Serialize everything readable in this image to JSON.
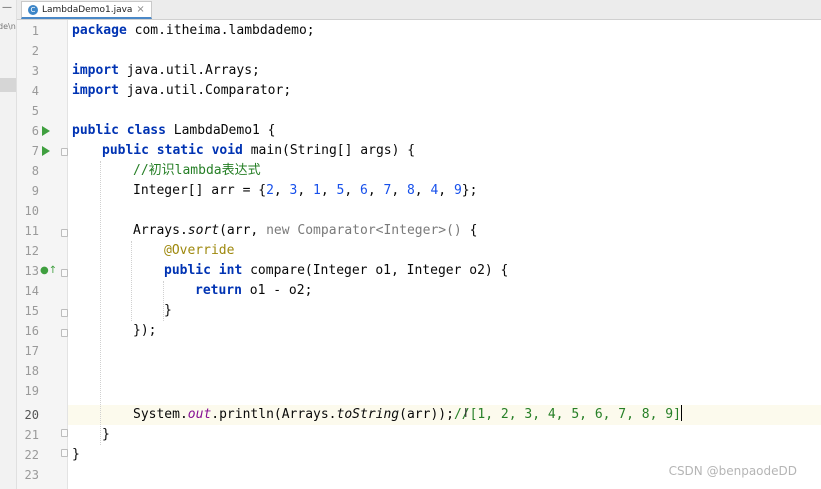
{
  "tab": {
    "filename": "LambdaDemo1.java",
    "icon_letter": "C",
    "close": "×"
  },
  "sidebar": {
    "crumb": "de\\n"
  },
  "gutter": {
    "line_numbers": [
      "1",
      "2",
      "3",
      "4",
      "5",
      "6",
      "7",
      "8",
      "9",
      "10",
      "11",
      "12",
      "13",
      "14",
      "15",
      "16",
      "17",
      "18",
      "19",
      "20",
      "21",
      "22",
      "23"
    ],
    "current_line": "20"
  },
  "code": {
    "l1_kw": "package",
    "l1_rest": " com.itheima.lambdademo;",
    "l3_kw": "import",
    "l3_rest": " java.util.Arrays;",
    "l4_kw": "import",
    "l4_rest": " java.util.Comparator;",
    "l6_kw": "public class",
    "l6_rest": " LambdaDemo1 {",
    "l7_kw": "public static void",
    "l7_rest": " main(String[] args) {",
    "l8_comment": "//初识lambda表达式",
    "l9_a": "Integer[] arr = {",
    "l9_nums": [
      "2",
      "3",
      "1",
      "5",
      "6",
      "7",
      "8",
      "4",
      "9"
    ],
    "l9_b": "};",
    "l11_a": "Arrays.",
    "l11_sort": "sort",
    "l11_b": "(arr, ",
    "l11_new": "new Comparator<Integer>()",
    "l11_c": " {",
    "l12_ann": "@Override",
    "l13_kw": "public int",
    "l13_rest": " compare(Integer o1, Integer o2) {",
    "l14_kw": "return",
    "l14_rest": " o1 - o2;",
    "l15": "}",
    "l16": "});",
    "l20_a": "System.",
    "l20_out": "out",
    "l20_b": ".println(Arrays.",
    "l20_tostr": "toString",
    "l20_c": "(arr));",
    "l20_comment": "//[1, 2, 3, 4, 5, 6, 7, 8, 9]",
    "l21": "}",
    "l22": "}"
  },
  "watermark": "CSDN @benpaodeDD",
  "colors": {
    "keyword": "#0033b3",
    "number": "#1750eb",
    "annotation": "#9e880d",
    "current_line_bg": "#fcfaed",
    "run_icon": "#3f9f3f"
  },
  "icons": {
    "run": "run-gutter-icon",
    "override": "override-gutter-icon",
    "fold": "fold-marker-icon"
  }
}
